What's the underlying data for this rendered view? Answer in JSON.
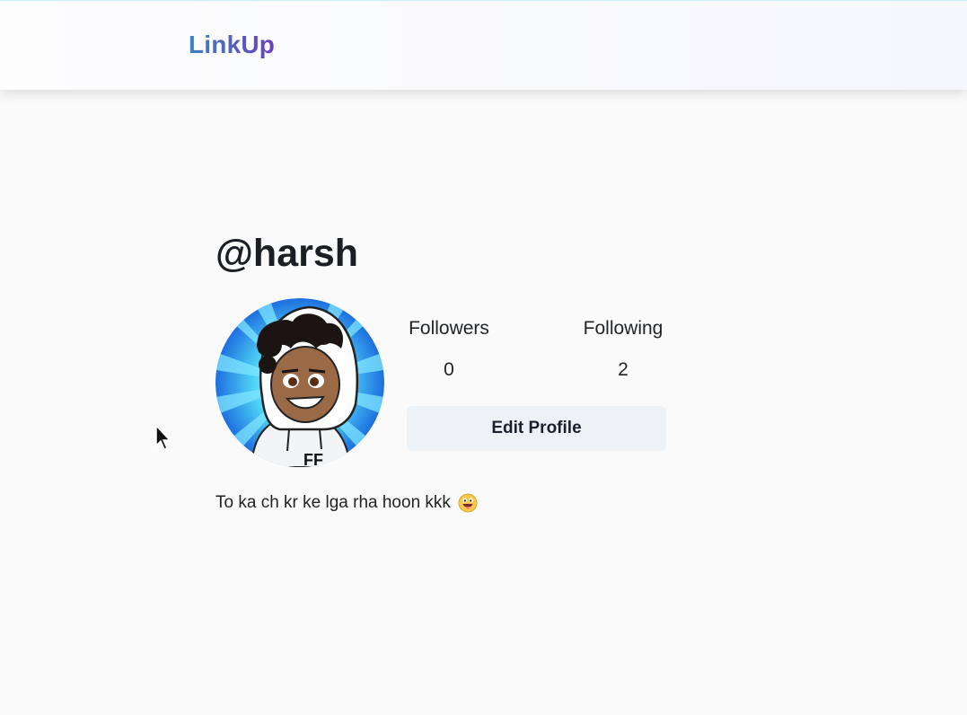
{
  "header": {
    "logo_text": "LinkUp"
  },
  "profile": {
    "username": "@harsh",
    "avatar_alt": "cartoon avatar in white hoodie",
    "stats": {
      "followers_label": "Followers",
      "followers_count": "0",
      "following_label": "Following",
      "following_count": "2"
    },
    "edit_button_label": "Edit Profile",
    "bio": "To ka ch kr ke lga rha hoon kkk"
  },
  "colors": {
    "logo_gradient_start": "#3b82c4",
    "logo_gradient_end": "#6a3fc0",
    "button_bg": "#edf2f7",
    "page_bg": "#fafafa"
  },
  "icons": {
    "bio_emoji": "grinning-face-with-tongue-icon",
    "cursor": "mouse-pointer-icon"
  }
}
